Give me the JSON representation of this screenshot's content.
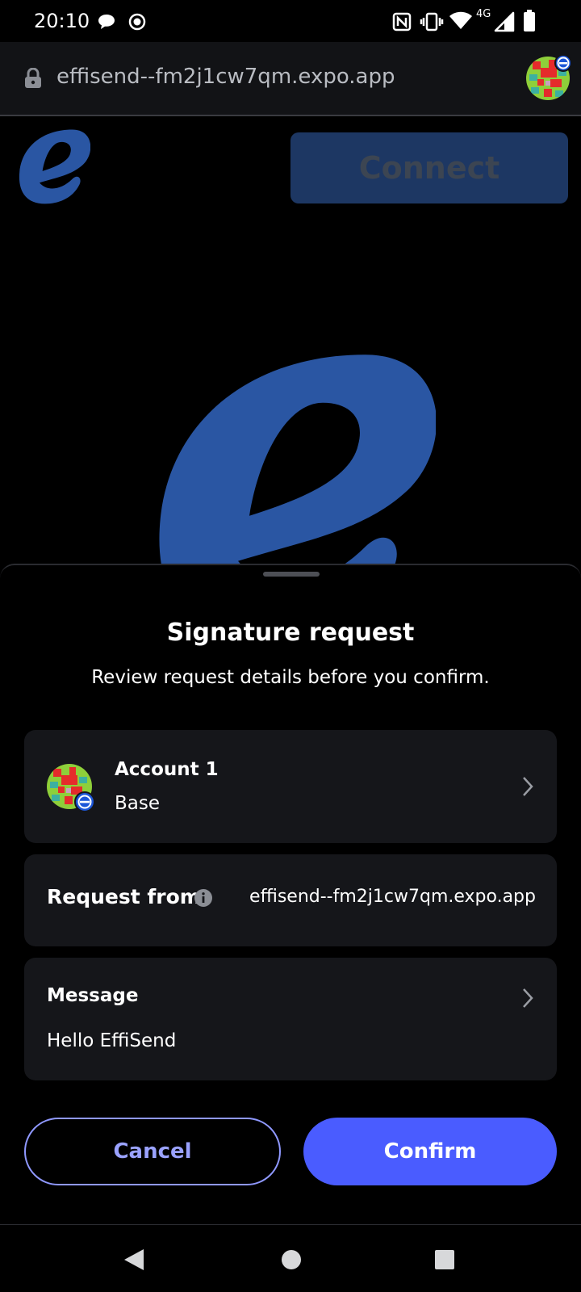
{
  "status_bar": {
    "time": "20:10",
    "network": "4G",
    "icons": [
      "chat-bubble-icon",
      "record-icon",
      "nfc-icon",
      "vibrate-icon",
      "wifi-icon",
      "signal-icon",
      "battery-icon"
    ]
  },
  "browser": {
    "url": "effisend--fm2j1cw7qm.expo.app",
    "icons": [
      "lock-icon",
      "wallet-avatar-icon"
    ]
  },
  "page": {
    "connect_label": "Connect",
    "brand_color": "#2a56a3"
  },
  "sheet": {
    "title": "Signature request",
    "subtitle": "Review request details before you confirm.",
    "account": {
      "name": "Account 1",
      "network": "Base"
    },
    "request": {
      "label": "Request from",
      "value": "effisend--fm2j1cw7qm.expo.app"
    },
    "message": {
      "label": "Message",
      "text": "Hello EffiSend"
    },
    "cancel_label": "Cancel",
    "confirm_label": "Confirm",
    "accent_color": "#4a5cff"
  },
  "nav_bar": {
    "icons": [
      "back-icon",
      "home-icon",
      "recents-icon"
    ]
  }
}
